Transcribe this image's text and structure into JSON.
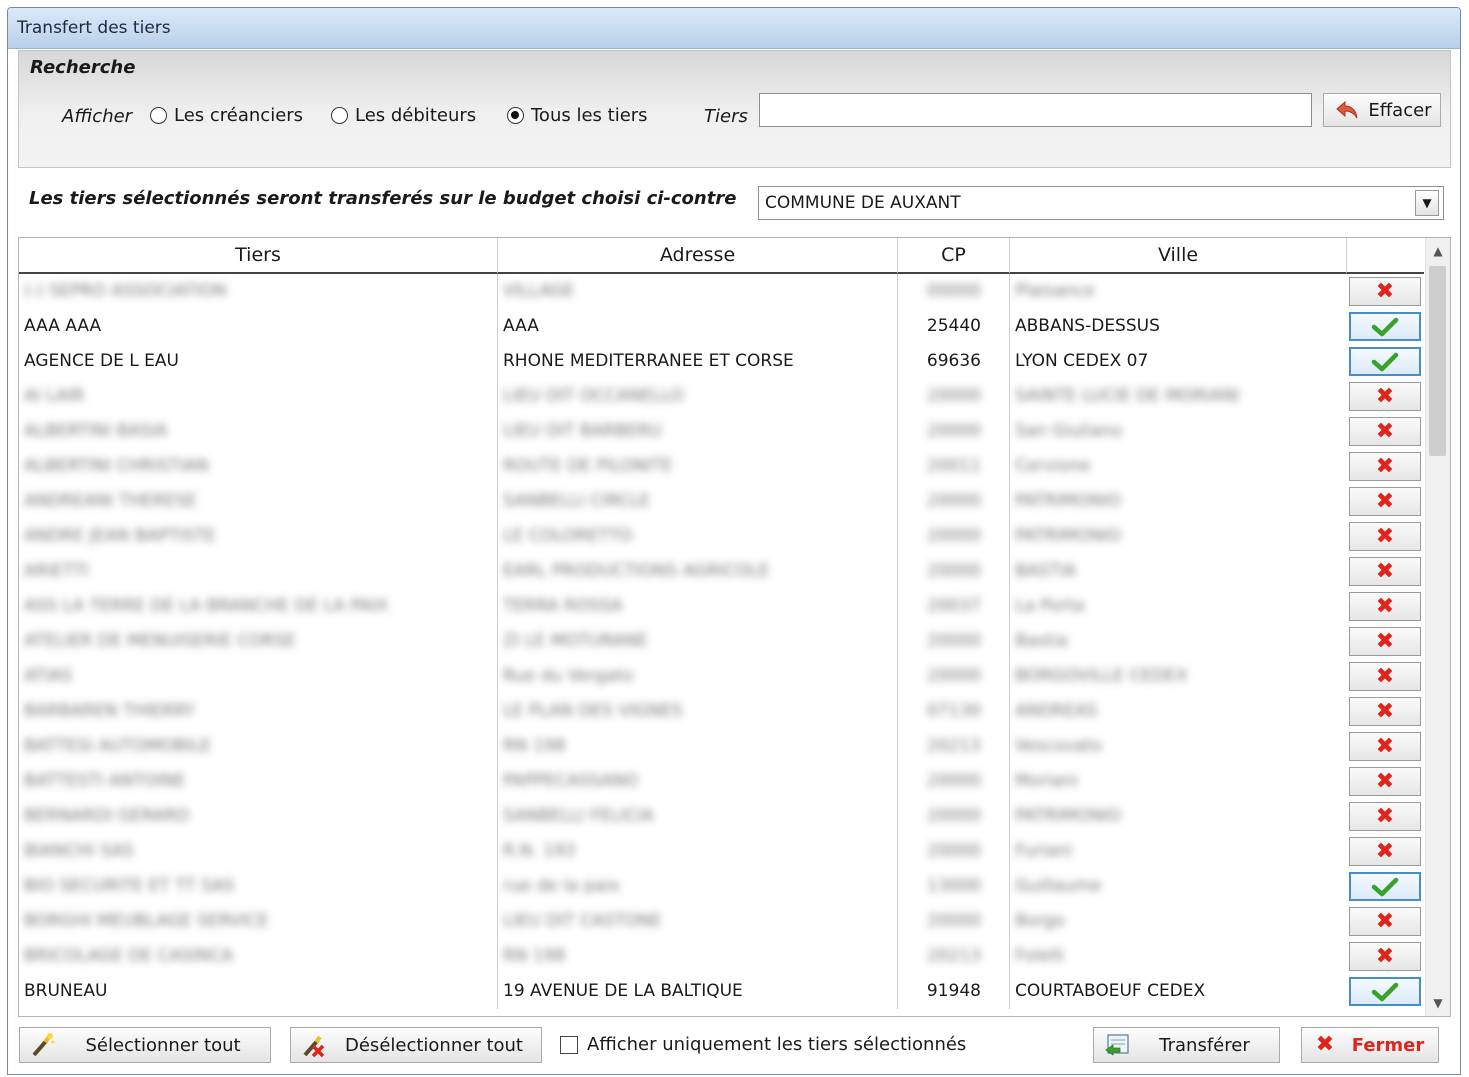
{
  "window": {
    "title": "Transfert des tiers"
  },
  "search": {
    "heading": "Recherche",
    "show_label": "Afficher",
    "options": [
      {
        "label": "Les créanciers",
        "selected": false
      },
      {
        "label": "Les débiteurs",
        "selected": false
      },
      {
        "label": "Tous les tiers",
        "selected": true
      }
    ],
    "tiers_label": "Tiers",
    "tiers_value": "",
    "clear_label": "Effacer"
  },
  "budget": {
    "label": "Les tiers sélectionnés seront transferés sur le budget choisi ci-contre",
    "selected": "COMMUNE DE AUXANT"
  },
  "grid": {
    "columns": [
      "Tiers",
      "Adresse",
      "CP",
      "Ville"
    ],
    "rows": [
      {
        "tiers": "(-) SEPRO ASSOCIATION",
        "adresse": "VILLAGE",
        "cp": "00000",
        "ville": "Plaisance",
        "blur": true,
        "selected": false
      },
      {
        "tiers": "AAA AAA",
        "adresse": "AAA",
        "cp": "25440",
        "ville": "ABBANS-DESSUS",
        "blur": false,
        "selected": true
      },
      {
        "tiers": "AGENCE DE L EAU",
        "adresse": "RHONE MEDITERRANEE ET CORSE",
        "cp": "69636",
        "ville": "LYON CEDEX 07",
        "blur": false,
        "selected": true
      },
      {
        "tiers": "AI LAIR",
        "adresse": "LIEU DIT OCCANELLO",
        "cp": "20000",
        "ville": "SAINTE LUCIE DE MORIANI",
        "blur": true,
        "selected": false
      },
      {
        "tiers": "ALBERTINI BASIA",
        "adresse": "LIEU DIT BARBERU",
        "cp": "20000",
        "ville": "San Giuliano",
        "blur": true,
        "selected": false
      },
      {
        "tiers": "ALBERTINI CHRISTIAN",
        "adresse": "ROUTE DE PILONITE",
        "cp": "20011",
        "ville": "Cervione",
        "blur": true,
        "selected": false
      },
      {
        "tiers": "ANDREANI THERESE",
        "adresse": "SANBELLI CIRCLE",
        "cp": "20000",
        "ville": "PATRIMONIO",
        "blur": true,
        "selected": false
      },
      {
        "tiers": "ANDRE JEAN BAPTISTE",
        "adresse": "LE COLORETTO",
        "cp": "20000",
        "ville": "PATRIMONIO",
        "blur": true,
        "selected": false
      },
      {
        "tiers": "ARIETTI",
        "adresse": "EARL PRODUCTIONS AGRICOLE",
        "cp": "20000",
        "ville": "BASTIA",
        "blur": true,
        "selected": false
      },
      {
        "tiers": "ASS LA TERRE DE LA BRANCHE DE LA PAIX",
        "adresse": "TERRA ROSSA",
        "cp": "20037",
        "ville": "La Porta",
        "blur": true,
        "selected": false
      },
      {
        "tiers": "ATELIER DE MENUISERIE CORSE",
        "adresse": "ZI LE MOTURANE",
        "cp": "20000",
        "ville": "Bastia",
        "blur": true,
        "selected": false
      },
      {
        "tiers": "ATIAS",
        "adresse": "Rue du Vergato",
        "cp": "20000",
        "ville": "BORGOVILLE CEDEX",
        "blur": true,
        "selected": false
      },
      {
        "tiers": "BARBAREN THIERRY",
        "adresse": "LE PLAN DES VIGNES",
        "cp": "07130",
        "ville": "ANDREAS",
        "blur": true,
        "selected": false
      },
      {
        "tiers": "BATTESI AUTOMOBILE",
        "adresse": "RN 198",
        "cp": "20213",
        "ville": "Vescovato",
        "blur": true,
        "selected": false
      },
      {
        "tiers": "BATTESTI ANTOINE",
        "adresse": "PAPPECASSANO",
        "cp": "20000",
        "ville": "Moriani",
        "blur": true,
        "selected": false
      },
      {
        "tiers": "BERNARDI GERARD",
        "adresse": "SANBELLI FELICIA",
        "cp": "20000",
        "ville": "PATRIMONIO",
        "blur": true,
        "selected": false
      },
      {
        "tiers": "BIANCHI SAS",
        "adresse": "R.N. 193",
        "cp": "20000",
        "ville": "Furiani",
        "blur": true,
        "selected": false
      },
      {
        "tiers": "BIO SECURITE ET TT SAS",
        "adresse": "rue de la paix",
        "cp": "13000",
        "ville": "Guillaume",
        "blur": true,
        "selected": true
      },
      {
        "tiers": "BORGHI MEUBLAGE SERVICE",
        "adresse": "LIEU DIT CASTONE",
        "cp": "20000",
        "ville": "Borgo",
        "blur": true,
        "selected": false
      },
      {
        "tiers": "BRICOLAGE DE CASINCA",
        "adresse": "RN 198",
        "cp": "20213",
        "ville": "Folelli",
        "blur": true,
        "selected": false
      },
      {
        "tiers": "BRUNEAU",
        "adresse": "19 AVENUE DE LA BALTIQUE",
        "cp": "91948",
        "ville": "COURTABOEUF CEDEX",
        "blur": false,
        "selected": true
      }
    ]
  },
  "footer": {
    "select_all": "Sélectionner tout",
    "deselect_all": "Désélectionner tout",
    "only_selected": "Afficher uniquement les tiers sélectionnés",
    "transfer": "Transférer",
    "close": "Fermer"
  },
  "icons": {
    "select_all": "magic-wand-icon",
    "deselect_all": "magic-wand-cross-icon",
    "clear": "undo-arrow-icon",
    "transfer": "transfer-icon",
    "close": "red-cross-icon",
    "row_selected": "green-check-icon",
    "row_unselected": "red-cross-icon"
  },
  "colors": {
    "accent_blue": "#4a8cc8",
    "red": "#e2231a",
    "green": "#3aa12a",
    "close_text": "#e2231a"
  }
}
